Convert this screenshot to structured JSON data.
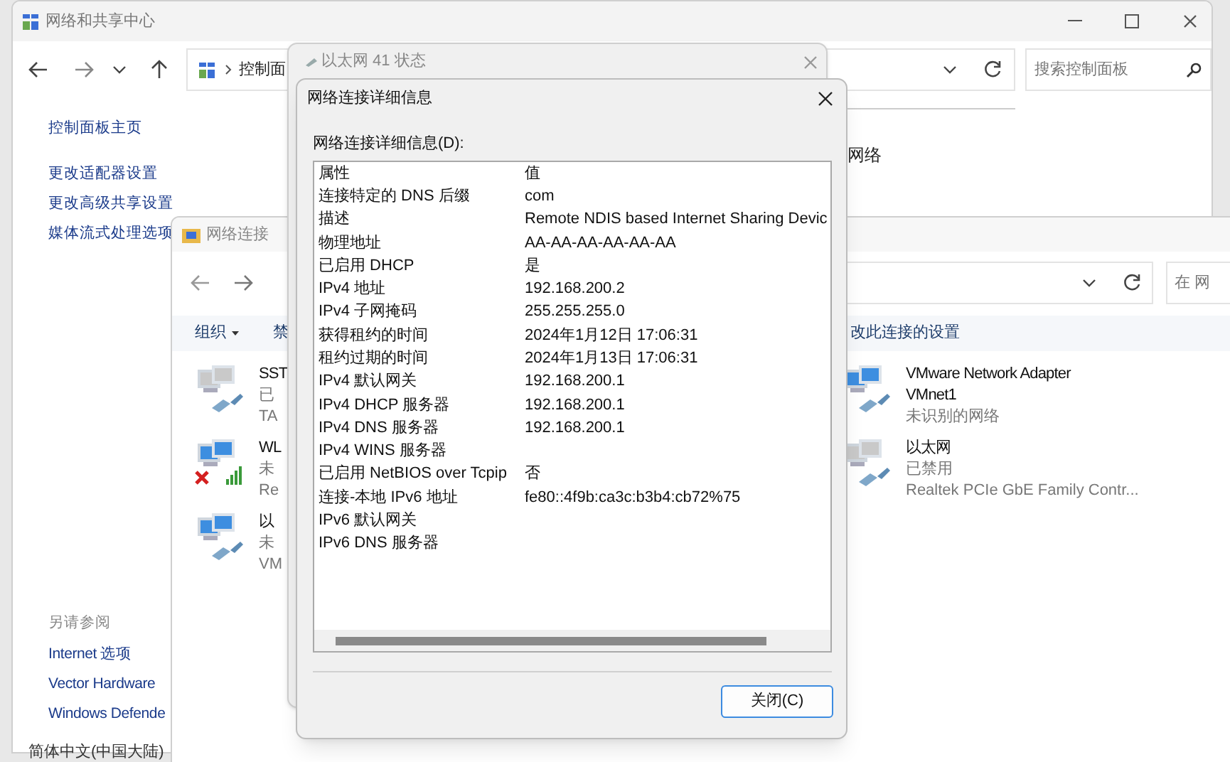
{
  "control_panel_window": {
    "title": "网络和共享中心",
    "address_text": "控制面",
    "search_placeholder": "搜索控制面板",
    "sidebar_links": [
      "控制面板主页",
      "更改适配器设置",
      "更改高级共享设置",
      "媒体流式处理选项"
    ],
    "content_fragment": "网络",
    "see_also_heading": "另请参阅",
    "see_also_links": [
      "Internet 选项",
      "Vector Hardware",
      "Windows Defende"
    ]
  },
  "network_connections_window": {
    "title": "网络连接",
    "search_placeholder": "在 网",
    "toolbar": [
      {
        "label": "组织",
        "kind": "menu"
      },
      {
        "label": "禁",
        "kind": "command"
      },
      {
        "label": "改此连接的设置",
        "kind": "command"
      }
    ],
    "adapters": [
      {
        "name": "SST",
        "status": "已",
        "device": "TA",
        "kind": "ethernet",
        "disabled": true,
        "disconnected": false
      },
      {
        "name": "WL",
        "status": "未",
        "device": "Re",
        "kind": "wifi",
        "disabled": false,
        "disconnected": true
      },
      {
        "name": "以",
        "status": "未",
        "device": "VM",
        "kind": "ethernet",
        "disabled": false,
        "disconnected": false
      },
      {
        "name": "VMware Network Adapter VMnet1",
        "status": "未识别的网络",
        "kind": "ethernet",
        "disabled": false,
        "disconnected": false
      },
      {
        "name": "以太网",
        "status": "已禁用",
        "device": "Realtek PCIe GbE Family Contr...",
        "kind": "ethernet",
        "disabled": true,
        "disconnected": false
      }
    ]
  },
  "status_window": {
    "title": "以太网 41 状态"
  },
  "details_dialog": {
    "title": "网络连接详细信息",
    "list_label": "网络连接详细信息(D):",
    "columns": [
      "属性",
      "值"
    ],
    "rows": [
      {
        "property": "连接特定的 DNS 后缀",
        "value": "com"
      },
      {
        "property": "描述",
        "value": "Remote NDIS based Internet Sharing Devic"
      },
      {
        "property": "物理地址",
        "value": "AA-AA-AA-AA-AA-AA"
      },
      {
        "property": "已启用 DHCP",
        "value": "是"
      },
      {
        "property": "IPv4 地址",
        "value": "192.168.200.2"
      },
      {
        "property": "IPv4 子网掩码",
        "value": "255.255.255.0"
      },
      {
        "property": "获得租约的时间",
        "value": "2024年1月12日 17:06:31"
      },
      {
        "property": "租约过期的时间",
        "value": "2024年1月13日 17:06:31"
      },
      {
        "property": "IPv4 默认网关",
        "value": "192.168.200.1"
      },
      {
        "property": "IPv4 DHCP 服务器",
        "value": "192.168.200.1"
      },
      {
        "property": "IPv4 DNS 服务器",
        "value": "192.168.200.1"
      },
      {
        "property": "IPv4 WINS 服务器"
      },
      {
        "property": "已启用 NetBIOS over Tcpip",
        "value": "否"
      },
      {
        "property": "连接-本地 IPv6 地址",
        "value": "fe80::4f9b:ca3c:b3b4:cb72%75"
      },
      {
        "property": "IPv6 默认网关"
      },
      {
        "property": "IPv6 DNS 服务器"
      }
    ],
    "close_button": "关闭(C)"
  },
  "language_indicator": "简体中文(中国大陆)"
}
